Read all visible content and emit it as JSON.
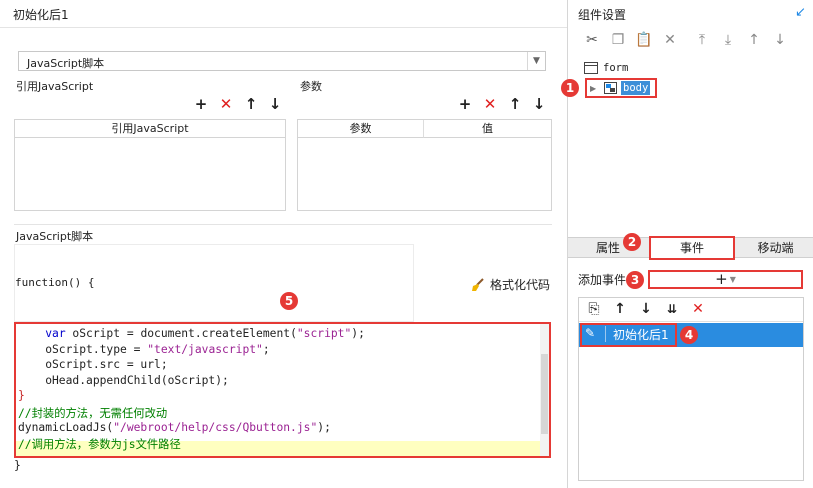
{
  "left_panel": {
    "title": "初始化后1",
    "script_type_select": {
      "value": "JavaScript脚本"
    },
    "ref_js": {
      "label": "引用JavaScript",
      "column_header": "引用JavaScript",
      "rows": []
    },
    "params": {
      "label": "参数",
      "columns": [
        "参数",
        "值"
      ],
      "rows": []
    },
    "script_section": {
      "label": "JavaScript脚本",
      "function_header": "function() {",
      "format_button_label": "格式化代码",
      "closing_brace": "}"
    },
    "code_lines": [
      {
        "tokens": [
          {
            "t": "    "
          },
          {
            "t": "var",
            "c": "kw"
          },
          {
            "t": " oScript = document.createElement("
          },
          {
            "t": "\"script\"",
            "c": "str2"
          },
          {
            "t": ");"
          }
        ]
      },
      {
        "tokens": [
          {
            "t": "    oScript.type = "
          },
          {
            "t": "\"text/javascript\"",
            "c": "str2"
          },
          {
            "t": ";"
          }
        ]
      },
      {
        "tokens": [
          {
            "t": "    oScript.src = url;"
          }
        ]
      },
      {
        "tokens": [
          {
            "t": "    oHead.appendChild(oScript);"
          }
        ]
      },
      {
        "tokens": [
          {
            "t": "}",
            "c": "brace-red"
          }
        ]
      },
      {
        "tokens": [
          {
            "t": "//封装的方法，无需任何改动",
            "c": "cmt"
          }
        ]
      },
      {
        "tokens": [
          {
            "t": "dynamicLoadJs("
          },
          {
            "t": "\"/webroot/help/css/Qbutton.js\"",
            "c": "str2"
          },
          {
            "t": ");"
          }
        ]
      },
      {
        "tokens": [
          {
            "t": "//调用方法，参数为js文件路径",
            "c": "cmt"
          }
        ]
      }
    ]
  },
  "right_panel": {
    "title": "组件设置",
    "toolbar_icons": [
      "cut-icon",
      "copy-icon",
      "paste-icon",
      "delete-icon",
      "move-top-icon",
      "move-bottom-icon",
      "move-up-icon",
      "move-down-icon"
    ],
    "tree": {
      "root_label": "form",
      "child_label": "body"
    },
    "tabs": [
      "属性",
      "事件",
      "移动端"
    ],
    "active_tab": "事件",
    "add_event_label": "添加事件",
    "add_event_button": "+",
    "events": [
      {
        "label": "初始化后1",
        "selected": true
      }
    ]
  },
  "annotations": {
    "badges": [
      "1",
      "2",
      "3",
      "4",
      "5"
    ],
    "color": "#e53935"
  },
  "colors": {
    "selection_blue": "#2a8ce0",
    "keyword_blue": "#0000cc",
    "comment_green": "#008000",
    "string_purple": "#9b2393",
    "highlight_yellow": "#ffffc0"
  }
}
